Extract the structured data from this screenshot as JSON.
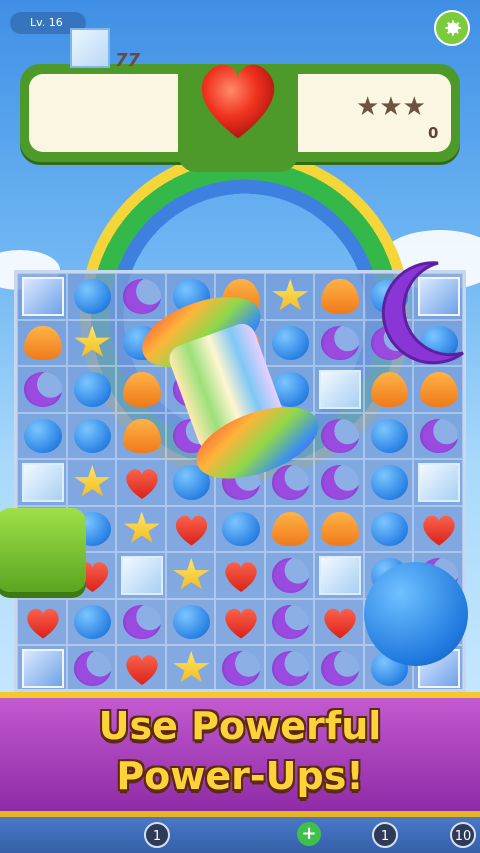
{
  "header": {
    "level_label": "Lv. 16",
    "settings_icon": "gear-icon"
  },
  "goals": {
    "glass_goal_icon": "glass-tile-icon",
    "glass_goal_count": "77",
    "heart_icon": "red-heart-icon",
    "stars": "★★★",
    "score": "0"
  },
  "board": {
    "rows": [
      [
        "glass-tnt",
        "blue-circle",
        "purple-moon",
        "blue-circle",
        "orange-teardrop",
        "yellow-star",
        "orange-teardrop",
        "blue-circle",
        "glass-tnt"
      ],
      [
        "orange-teardrop",
        "yellow-star",
        "blue-circle",
        "yellow-star",
        "orange-teardrop",
        "blue-circle",
        "purple-moon",
        "purple-moon",
        "blue-circle"
      ],
      [
        "purple-moon",
        "blue-circle",
        "orange-teardrop",
        "purple-moon",
        "blue-circle",
        "blue-circle",
        "glass",
        "orange-teardrop",
        "orange-teardrop"
      ],
      [
        "blue-circle",
        "blue-circle",
        "orange-teardrop",
        "purple-moon",
        "blue-circle",
        "blue-circle",
        "purple-moon",
        "blue-circle",
        "purple-moon"
      ],
      [
        "glass",
        "yellow-star",
        "red-heart",
        "blue-circle",
        "purple-moon",
        "purple-moon",
        "purple-moon",
        "blue-circle",
        "glass"
      ],
      [
        "blue-circle",
        "blue-circle",
        "yellow-star",
        "red-heart",
        "blue-circle",
        "orange-teardrop",
        "orange-teardrop",
        "blue-circle",
        "red-heart"
      ],
      [
        "orange-teardrop",
        "red-heart",
        "glass",
        "yellow-star",
        "red-heart",
        "purple-moon",
        "glass",
        "blue-circle",
        "purple-moon"
      ],
      [
        "red-heart",
        "blue-circle",
        "purple-moon",
        "blue-circle",
        "red-heart",
        "purple-moon",
        "red-heart",
        "blue-circle",
        "red-heart"
      ],
      [
        "glass-tnt",
        "purple-moon",
        "red-heart",
        "yellow-star",
        "purple-moon",
        "purple-moon",
        "purple-moon",
        "blue-circle",
        "glass-tnt"
      ]
    ]
  },
  "powerup": {
    "icon": "rainbow-rocket-icon"
  },
  "banner": {
    "line1": "Use Powerful",
    "line2": "Power-Ups!"
  },
  "boosters": [
    {
      "count": "1"
    },
    {
      "count": "1"
    },
    {
      "count": "10"
    }
  ],
  "colors": {
    "accent_green": "#4d9a2a",
    "banner_purple": "#a83fc0",
    "banner_text": "#ffd23a"
  }
}
